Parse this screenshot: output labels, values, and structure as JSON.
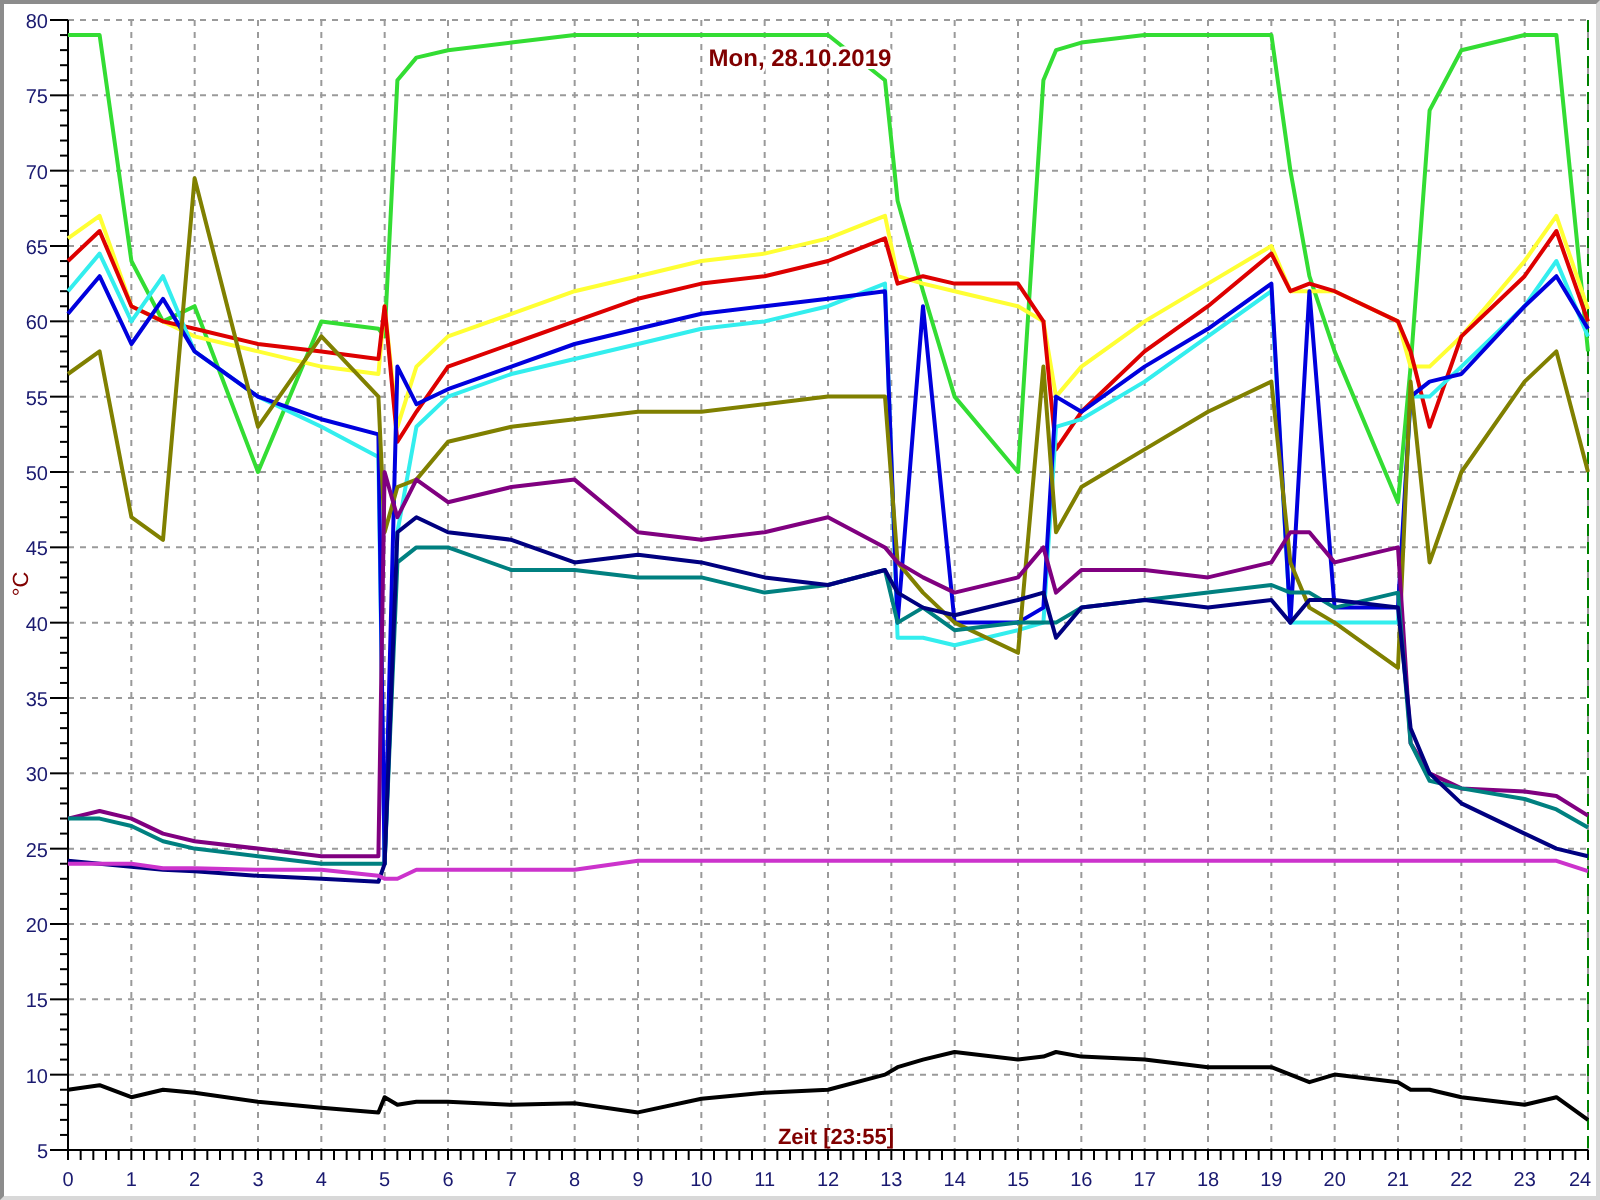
{
  "chart": {
    "chart_data": {
      "type": "line",
      "title": "Mon, 28.10.2019",
      "xlabel": "Zeit [23:55]",
      "ylabel": "°C",
      "x": [
        0,
        0.5,
        1,
        1.5,
        2,
        3,
        4,
        4.9,
        5,
        5.2,
        5.5,
        6,
        7,
        8,
        9,
        10,
        11,
        12,
        12.9,
        13.1,
        13.5,
        14,
        15,
        15.4,
        15.6,
        16,
        17,
        18,
        19,
        19.3,
        19.6,
        20,
        21,
        21.2,
        21.5,
        22,
        23,
        23.5,
        24
      ],
      "series": [
        {
          "color": "#33dd33",
          "values": [
            79,
            79,
            64,
            60,
            61,
            50,
            60,
            59.5,
            59,
            76,
            77.5,
            78,
            78.5,
            79,
            79,
            79,
            79,
            79,
            76,
            68,
            62,
            55,
            50,
            76,
            78,
            78.5,
            79,
            79,
            79,
            70,
            63,
            58,
            48,
            57,
            74,
            78,
            79,
            79,
            58
          ]
        },
        {
          "color": "#ffff33",
          "values": [
            65.5,
            67,
            61,
            60,
            59,
            58,
            57,
            56.5,
            61,
            53,
            57,
            59,
            60.5,
            62,
            63,
            64,
            64.5,
            65.5,
            67,
            63,
            62.5,
            62,
            61,
            60,
            55,
            57,
            60,
            62.5,
            65,
            62,
            62,
            62,
            60,
            57,
            57,
            59,
            64,
            67,
            60.8
          ]
        },
        {
          "color": "#dd0000",
          "values": [
            64,
            66,
            61,
            60,
            59.5,
            58.5,
            58,
            57.5,
            61,
            52,
            54,
            57,
            58.5,
            60,
            61.5,
            62.5,
            63,
            64,
            65.5,
            62.5,
            63,
            62.5,
            62.5,
            60,
            51.5,
            54,
            58,
            61,
            64.5,
            62,
            62.5,
            62,
            60,
            58,
            53,
            59,
            63,
            66,
            60
          ]
        },
        {
          "color": "#33eeee",
          "values": [
            62,
            64.5,
            60,
            63,
            58,
            55,
            53,
            51,
            24,
            46,
            53,
            55,
            56.5,
            57.5,
            58.5,
            59.5,
            60,
            61,
            62.5,
            39,
            39,
            38.5,
            39.5,
            40,
            53,
            53.5,
            56,
            59,
            62,
            40,
            40,
            40,
            40,
            55,
            55,
            57,
            61,
            64,
            59
          ]
        },
        {
          "color": "#0000dd",
          "values": [
            60.5,
            63,
            58.5,
            61.5,
            58,
            55,
            53.5,
            52.5,
            24,
            57,
            54.5,
            55.5,
            57,
            58.5,
            59.5,
            60.5,
            61,
            61.5,
            62,
            40,
            61,
            40,
            40,
            41,
            55,
            54,
            57,
            59.5,
            62.5,
            40,
            62,
            41,
            41,
            55,
            56,
            56.5,
            61,
            63,
            59.5
          ]
        },
        {
          "color": "#808000",
          "values": [
            56.5,
            58,
            47,
            45.5,
            69.5,
            53,
            59,
            55,
            46,
            49,
            49.5,
            52,
            53,
            53.5,
            54,
            54,
            54.5,
            55,
            55,
            44,
            42,
            40,
            38,
            57,
            46,
            49,
            51.5,
            54,
            56,
            44,
            41,
            40,
            37,
            56,
            44,
            50,
            56,
            58,
            50
          ]
        },
        {
          "color": "#800080",
          "values": [
            27,
            27.5,
            27,
            26,
            25.5,
            25,
            24.5,
            24.5,
            50,
            47,
            49.5,
            48,
            49,
            49.5,
            46,
            45.5,
            46,
            47,
            45,
            44,
            43,
            42,
            43,
            45,
            42,
            43.5,
            43.5,
            43,
            44,
            46,
            46,
            44,
            45,
            32,
            30,
            29,
            28.8,
            28.5,
            27.2
          ]
        },
        {
          "color": "#008080",
          "values": [
            27,
            27,
            26.5,
            25.5,
            25,
            24.5,
            24,
            24,
            24,
            44,
            45,
            45,
            43.5,
            43.5,
            43,
            43,
            42,
            42.5,
            43.5,
            40,
            41,
            39.5,
            40,
            40,
            40,
            41,
            41.5,
            42,
            42.5,
            42,
            42,
            41,
            42,
            32,
            29.5,
            29,
            28.3,
            27.6,
            26.4
          ]
        },
        {
          "color": "#000080",
          "values": [
            24.2,
            24,
            23.8,
            23.6,
            23.5,
            23.2,
            23,
            22.8,
            24,
            46,
            47,
            46,
            45.5,
            44,
            44.5,
            44,
            43,
            42.5,
            43.5,
            42,
            41,
            40.5,
            41.5,
            42,
            39,
            41,
            41.5,
            41,
            41.5,
            40,
            41.5,
            41.5,
            41,
            33,
            30,
            28,
            26,
            25,
            24.5
          ]
        },
        {
          "color": "#cc33cc",
          "values": [
            24,
            24,
            24,
            23.7,
            23.7,
            23.6,
            23.6,
            23.2,
            23,
            23,
            23.6,
            23.6,
            23.6,
            23.6,
            24.2,
            24.2,
            24.2,
            24.2,
            24.2,
            24.2,
            24.2,
            24.2,
            24.2,
            24.2,
            24.2,
            24.2,
            24.2,
            24.2,
            24.2,
            24.2,
            24.2,
            24.2,
            24.2,
            24.2,
            24.2,
            24.2,
            24.2,
            24.2,
            23.5
          ]
        },
        {
          "color": "#000000",
          "values": [
            9,
            9.3,
            8.5,
            9,
            8.8,
            8.2,
            7.8,
            7.5,
            8.5,
            8,
            8.2,
            8.2,
            8,
            8.1,
            7.5,
            8.4,
            8.8,
            9,
            10,
            10.5,
            11,
            11.5,
            11,
            11.2,
            11.5,
            11.2,
            11,
            10.5,
            10.5,
            10,
            9.5,
            10,
            9.5,
            9,
            9,
            8.5,
            8,
            8.5,
            7
          ]
        }
      ],
      "xlim": [
        0,
        24
      ],
      "ylim": [
        5,
        80
      ],
      "grid": true,
      "xticks": [
        0,
        1,
        2,
        3,
        4,
        5,
        6,
        7,
        8,
        9,
        10,
        11,
        12,
        13,
        14,
        15,
        16,
        17,
        18,
        19,
        20,
        21,
        22,
        23,
        24
      ],
      "yticks": [
        5,
        10,
        15,
        20,
        25,
        30,
        35,
        40,
        45,
        50,
        55,
        60,
        65,
        70,
        75,
        80
      ]
    }
  }
}
